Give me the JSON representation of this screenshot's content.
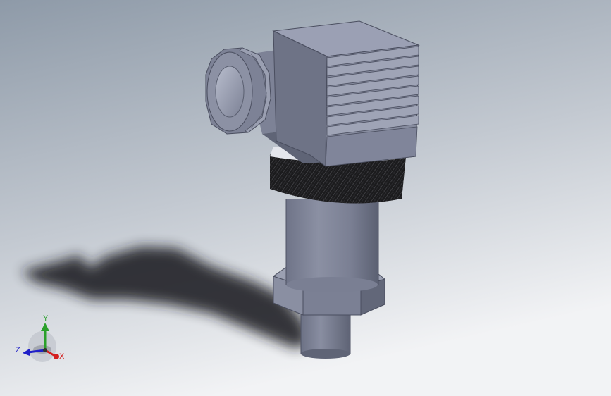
{
  "viewport": {
    "background_top": "#8e9aa8",
    "background_bottom": "#f2f3f5"
  },
  "model": {
    "body_color": "#7d8296",
    "body_dark": "#5b6072",
    "body_light": "#aab0c2",
    "knurl_color": "#141414",
    "shadow_color": "#1b1c20"
  },
  "triad": {
    "x_label": "X",
    "y_label": "Y",
    "z_label": "Z",
    "x_color": "#d42020",
    "y_color": "#2aa02a",
    "z_color": "#2020c8"
  }
}
